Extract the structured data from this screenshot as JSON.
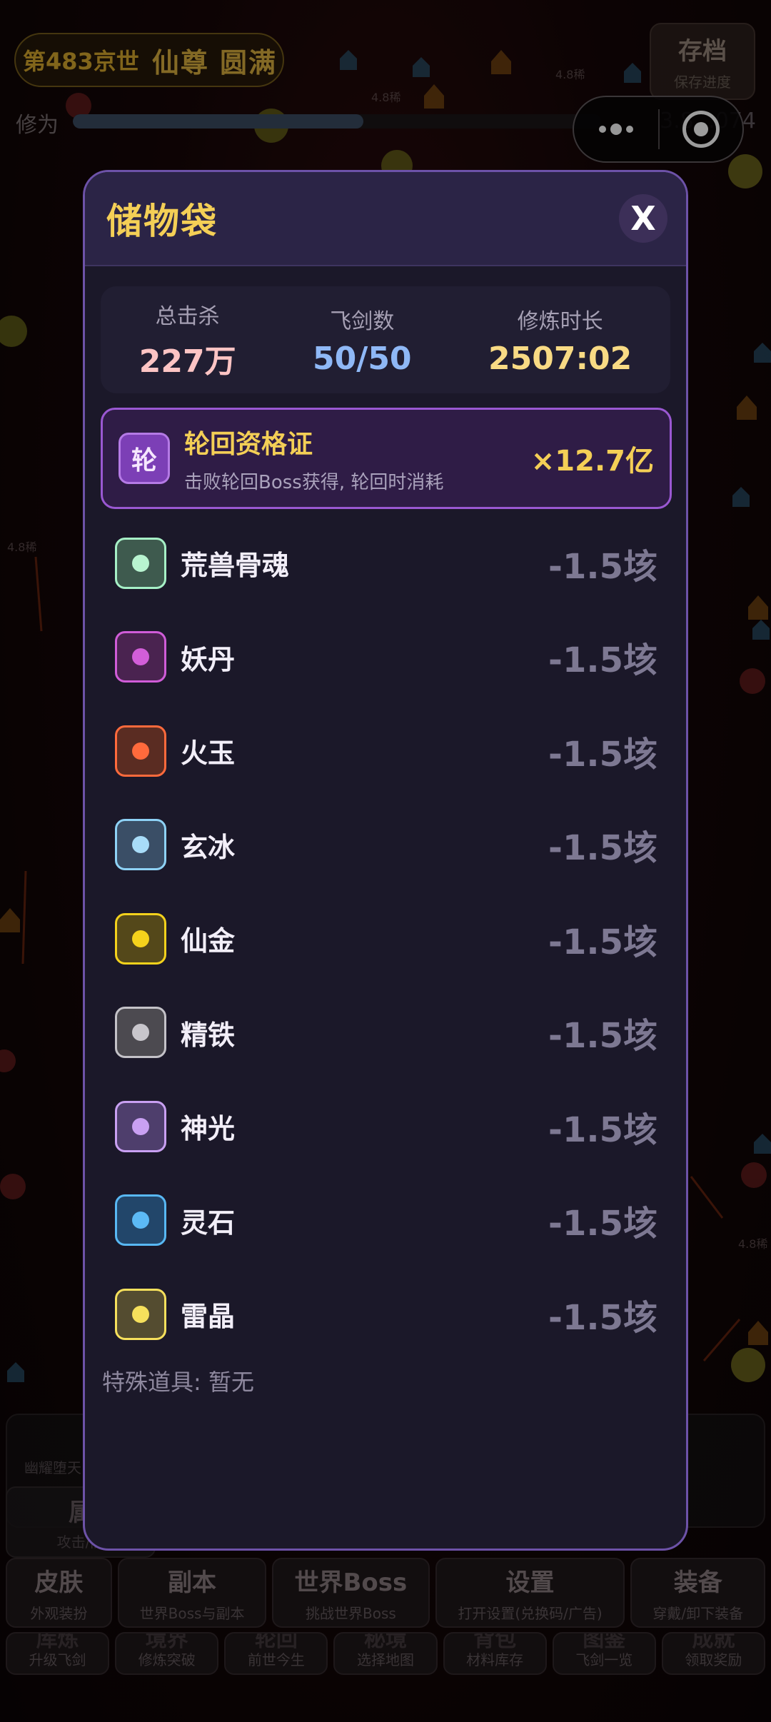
{
  "background": {
    "realm_era": "第483京世",
    "realm_name": "仙尊 圆满",
    "save": {
      "title": "存档",
      "subtitle": "保存进度"
    },
    "xp_label": "修为",
    "xp_progress": 0.55,
    "xp_value": "3.8…074",
    "panel_hint": "幽耀堕天",
    "attr_button": {
      "title": "属",
      "subtitle": "攻击/防"
    },
    "menu_row1": [
      {
        "title": "皮肤",
        "subtitle": "外观装扮"
      },
      {
        "title": "副本",
        "subtitle": "世界Boss与副本"
      },
      {
        "title": "世界Boss",
        "subtitle": "挑战世界Boss"
      },
      {
        "title": "设置",
        "subtitle": "打开设置(兑换码/广告)"
      },
      {
        "title": "装备",
        "subtitle": "穿戴/卸下装备"
      }
    ],
    "menu_row2": [
      {
        "title": "库炼",
        "subtitle": "升级飞剑"
      },
      {
        "title": "境界",
        "subtitle": "修炼突破"
      },
      {
        "title": "轮回",
        "subtitle": "前世今生"
      },
      {
        "title": "秘境",
        "subtitle": "选择地图"
      },
      {
        "title": "背包",
        "subtitle": "材料库存"
      },
      {
        "title": "图鉴",
        "subtitle": "飞剑一览"
      },
      {
        "title": "成就",
        "subtitle": "领取奖励"
      }
    ],
    "damage_tag": "4.8稀"
  },
  "modal": {
    "title": "储物袋",
    "close_label": "X",
    "stats": [
      {
        "label": "总击杀",
        "value": "227万",
        "color": "#fdc4c4"
      },
      {
        "label": "飞剑数",
        "value": "50/50",
        "color": "#8fb8f6"
      },
      {
        "label": "修炼时长",
        "value": "2507:02",
        "color": "#f8da84"
      }
    ],
    "featured": {
      "icon_char": "轮",
      "name": "轮回资格证",
      "description": "击败轮回Boss获得, 轮回时消耗",
      "count": "×12.7亿"
    },
    "items": [
      {
        "name": "荒兽骨魂",
        "qty": "-1.5垓",
        "border": "#a6f0c6",
        "fill": "#3e5a4e",
        "dot": "#b8f4d0"
      },
      {
        "name": "妖丹",
        "qty": "-1.5垓",
        "border": "#d05cd8",
        "fill": "#4a2350",
        "dot": "#d25ed8"
      },
      {
        "name": "火玉",
        "qty": "-1.5垓",
        "border": "#ff6a3c",
        "fill": "#5a2c22",
        "dot": "#ff6a3c"
      },
      {
        "name": "玄冰",
        "qty": "-1.5垓",
        "border": "#8ed2f6",
        "fill": "#3a4e66",
        "dot": "#a8dcf8"
      },
      {
        "name": "仙金",
        "qty": "-1.5垓",
        "border": "#f4d21c",
        "fill": "#54481a",
        "dot": "#f4d21c"
      },
      {
        "name": "精铁",
        "qty": "-1.5垓",
        "border": "#c4c2c8",
        "fill": "#4c4a50",
        "dot": "#c8c6cc"
      },
      {
        "name": "神光",
        "qty": "-1.5垓",
        "border": "#c9a0f2",
        "fill": "#4e3e6c",
        "dot": "#c9a0f2"
      },
      {
        "name": "灵石",
        "qty": "-1.5垓",
        "border": "#58b8f4",
        "fill": "#22466a",
        "dot": "#5cbaf6"
      },
      {
        "name": "雷晶",
        "qty": "-1.5垓",
        "border": "#f6e05c",
        "fill": "#544c30",
        "dot": "#f6e05c"
      }
    ],
    "special_label": "特殊道具: 暂无"
  }
}
